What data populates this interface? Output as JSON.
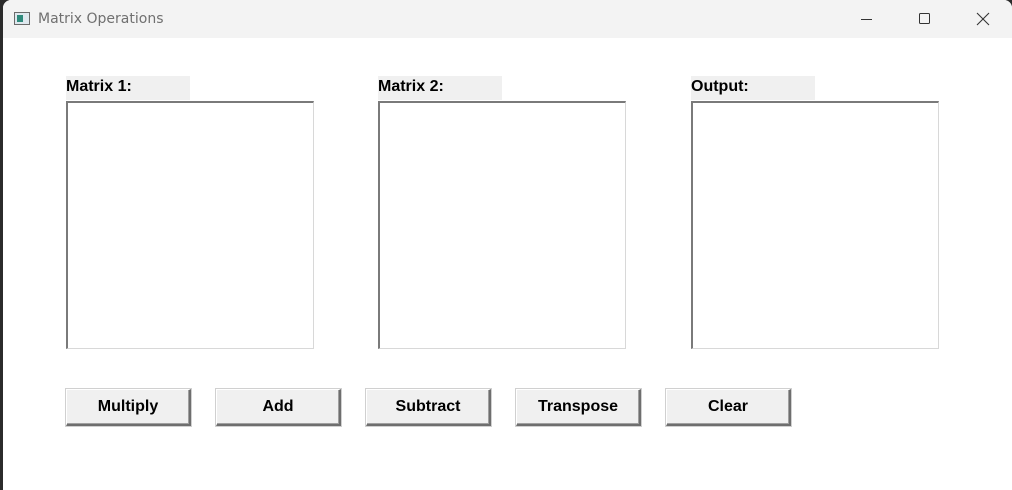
{
  "window": {
    "title": "Matrix Operations",
    "controls": {
      "minimize": "minimize",
      "maximize": "maximize",
      "close": "close"
    }
  },
  "panels": {
    "matrix1": {
      "label": "Matrix 1:",
      "value": ""
    },
    "matrix2": {
      "label": "Matrix 2:",
      "value": ""
    },
    "output": {
      "label": "Output:",
      "value": ""
    }
  },
  "buttons": {
    "multiply": "Multiply",
    "add": "Add",
    "subtract": "Subtract",
    "transpose": "Transpose",
    "clear": "Clear"
  },
  "icons": {
    "app": "app-window-icon",
    "minimize": "minimize-icon",
    "maximize": "maximize-icon",
    "close": "close-icon"
  },
  "colors": {
    "label_bg": "#f0f0f0",
    "button_bg": "#f0f0f0",
    "titlebar_bg": "#f3f3f3"
  }
}
